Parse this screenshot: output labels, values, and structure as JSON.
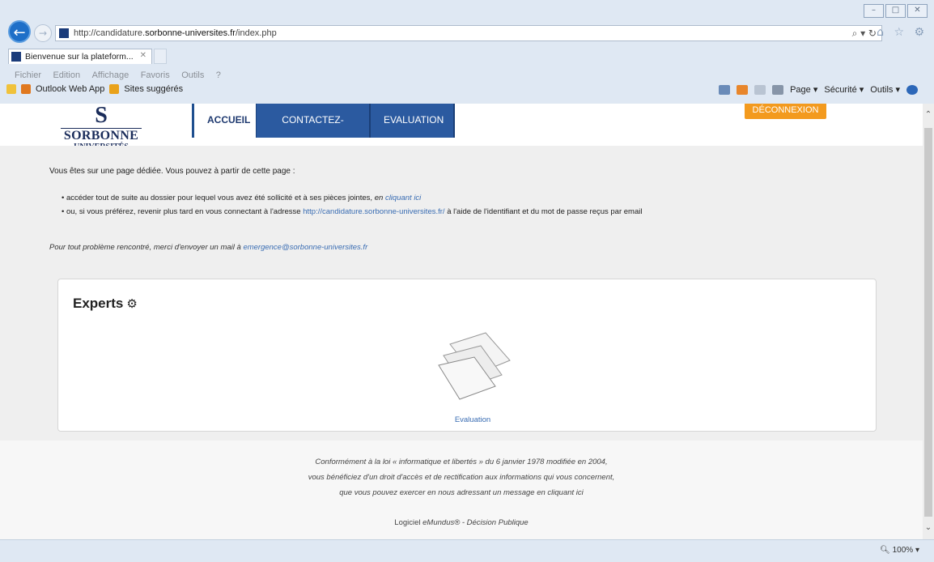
{
  "browser": {
    "url_prefix": "http://candidature.",
    "url_domain": "sorbonne-universites.fr",
    "url_suffix": "/index.php",
    "addr_tools": "⌕ ▾ ↻",
    "right_icons": "⌂ ☆ ⚙",
    "tab_label": "Bienvenue sur la plateform...",
    "tab_close": "✕",
    "menu": [
      "Fichier",
      "Edition",
      "Affichage",
      "Favoris",
      "Outils",
      "?"
    ],
    "favorites": [
      "Outlook Web App",
      "Sites suggérés"
    ],
    "commands": [
      "Page ▾",
      "Sécurité ▾",
      "Outils ▾"
    ],
    "zoom": "100%",
    "window_buttons": [
      "–",
      "□",
      "✕"
    ]
  },
  "logo": {
    "mark": "S",
    "line1": "SORBONNE",
    "line2": "UNIVERSITÉS"
  },
  "nav": {
    "accueil": "ACCUEIL",
    "contact": "CONTACTEZ-NOUS",
    "evaluation": "EVALUATION",
    "logout": "DÉCONNEXION"
  },
  "content": {
    "intro": "Vous êtes sur une page dédiée. Vous pouvez à partir de cette page :",
    "bullet1_text": "accéder tout de suite au dossier pour lequel vous avez été sollicité et à ses pièces jointes, ",
    "bullet1_em": "en ",
    "bullet1_link": "cliquant ici",
    "bullet2_text": "ou, si vous préférez, revenir plus tard en vous connectant à l'adresse ",
    "bullet2_link": "http://candidature.sorbonne-universites.fr/",
    "bullet2_tail": " à l'aide de l'identifiant et du mot de passe reçus par email",
    "problem_text": "Pour tout problème rencontré, merci d'envoyer un mail à ",
    "problem_link": "emergence@sorbonne-universites.fr",
    "panel_title": "Experts",
    "eval_label": "Evaluation"
  },
  "footer": {
    "line1": "Conformément à la loi « informatique et libertés » du 6 janvier 1978 modifiée en 2004,",
    "line2": "vous bénéficiez d'un droit d'accès et de rectification aux informations qui vous concernent,",
    "line3_text": "que vous pouvez exercer en nous adressant un message ",
    "line3_link": "en cliquant ici",
    "line4_a": "Logiciel ",
    "line4_b": "eMundus® - Décision Publique"
  },
  "colors": {
    "nav_blue": "#2b5aa0",
    "logout_orange": "#f39a1e",
    "link_blue": "#3a6db3",
    "band_gray": "#efefef"
  }
}
